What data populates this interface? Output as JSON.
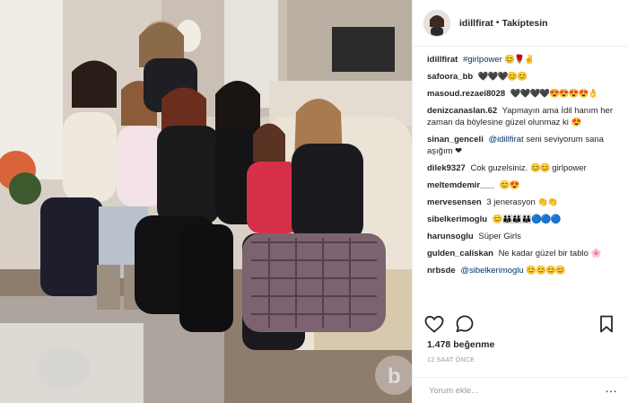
{
  "post": {
    "username": "idillfirat",
    "separator": "•",
    "follow_label": "Takiptesin"
  },
  "comments": [
    {
      "user": "idillfirat",
      "text": "",
      "hashtag": "#girlpower",
      "emoji": "😊🌹✌"
    },
    {
      "user": "safoora_bb",
      "text": "",
      "emoji": "🖤🖤🖤😊😊"
    },
    {
      "user": "masoud.rezaei8028",
      "text": "",
      "emoji": "🖤🖤🖤🖤😍😍😍😍👌"
    },
    {
      "user": "denizcanaslan.62",
      "text": "Yapmayın ama İdil hanım her zaman da böylesine güzel olunmaz ki",
      "emoji": "😍"
    },
    {
      "user": "sinan_genceli",
      "mention": "@idillfirat",
      "text": "seni seviyorum sana aşığım",
      "emoji": "❤"
    },
    {
      "user": "dilek9327",
      "text": "Cok guzelsiniz.",
      "emoji": "😊😊",
      "text2": "girlpower"
    },
    {
      "user": "meltemdemir___",
      "text": "",
      "emoji": "😊😍"
    },
    {
      "user": "mervesensen",
      "text": "3 jenerasyon",
      "emoji": "👏👏"
    },
    {
      "user": "sibelkerimoglu",
      "text": "",
      "emoji": "😊👪👪👪🔵🔵🔵"
    },
    {
      "user": "harunsoglu",
      "text": "Süper Girls",
      "emoji": ""
    },
    {
      "user": "gulden_caliskan",
      "text": "Ne kadar güzel bir tablo",
      "emoji": "🌸"
    },
    {
      "user": "nrbsde",
      "mention": "@sibelkerimoglu",
      "text": "",
      "emoji": "😊😊😊😊"
    }
  ],
  "likes": "1.478 beğenme",
  "time_ago": "12 SAAT ÖNCE",
  "comment_input": {
    "placeholder": "Yorum ekle...",
    "more": "…"
  },
  "icons": [
    "heart-icon",
    "comment-icon",
    "bookmark-icon",
    "profile-avatar"
  ]
}
